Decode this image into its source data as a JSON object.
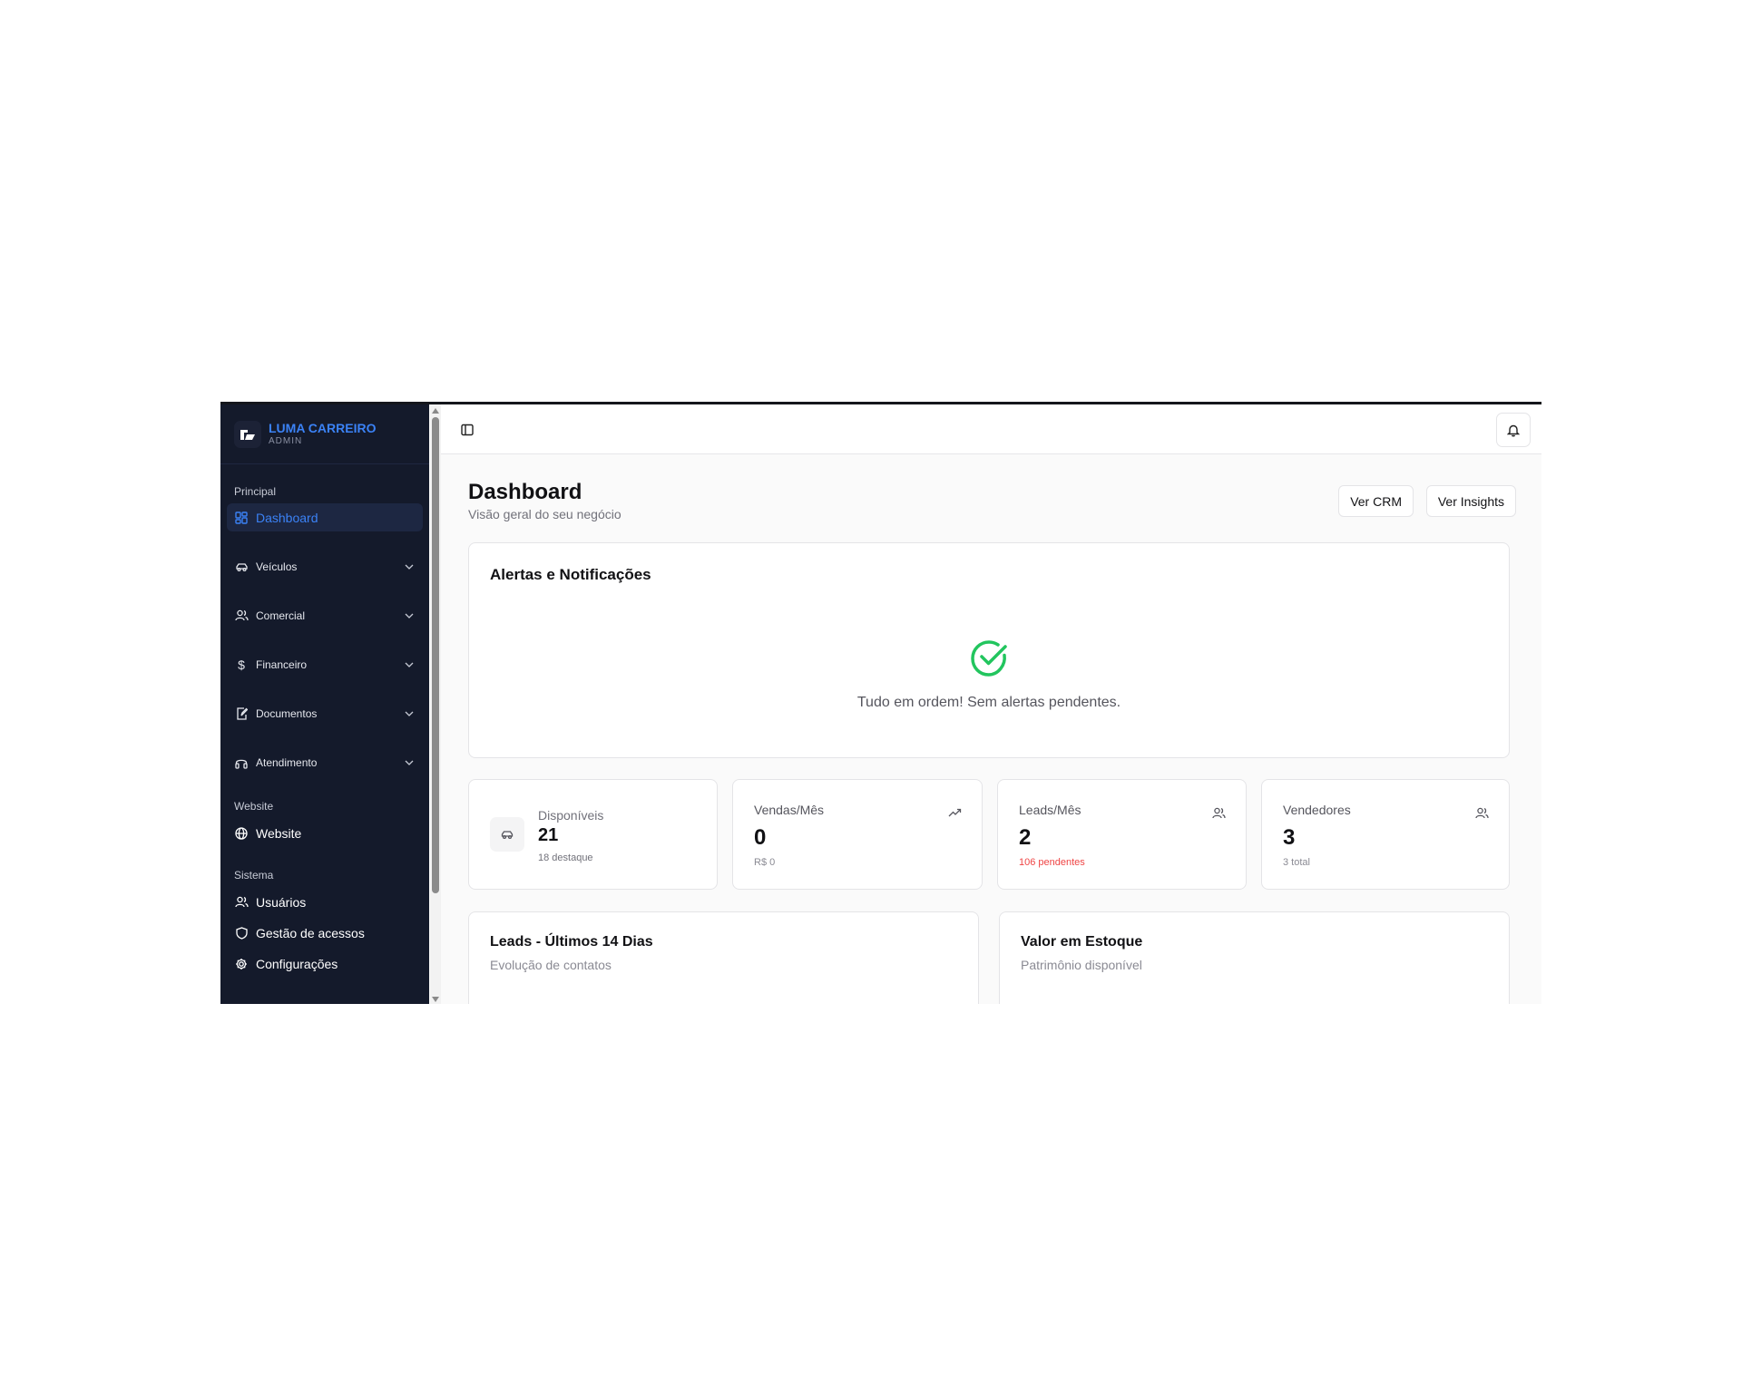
{
  "brand": {
    "name": "LUMA CARREIRO",
    "role": "ADMIN"
  },
  "sidebar": {
    "section_principal": "Principal",
    "dashboard": "Dashboard",
    "groups": [
      {
        "label": "Veículos",
        "icon": "car-icon"
      },
      {
        "label": "Comercial",
        "icon": "users-icon"
      },
      {
        "label": "Financeiro",
        "icon": "dollar-icon"
      },
      {
        "label": "Documentos",
        "icon": "document-edit-icon"
      },
      {
        "label": "Atendimento",
        "icon": "headset-icon"
      }
    ],
    "section_website": "Website",
    "website": "Website",
    "section_sistema": "Sistema",
    "usuarios": "Usuários",
    "gestao": "Gestão de acessos",
    "config": "Configurações"
  },
  "page": {
    "title": "Dashboard",
    "subtitle": "Visão geral do seu negócio",
    "btn_crm": "Ver CRM",
    "btn_insights": "Ver Insights"
  },
  "alerts": {
    "title": "Alertas e Notificações",
    "message": "Tudo em ordem! Sem alertas pendentes."
  },
  "stats": {
    "disponiveis": {
      "label": "Disponíveis",
      "value": "21",
      "foot": "18 destaque"
    },
    "vendas": {
      "label": "Vendas/Mês",
      "value": "0",
      "foot": "R$ 0"
    },
    "leads": {
      "label": "Leads/Mês",
      "value": "2",
      "foot": "106 pendentes"
    },
    "vendedores": {
      "label": "Vendedores",
      "value": "3",
      "foot": "3 total"
    }
  },
  "charts": {
    "leads": {
      "title": "Leads - Últimos 14 Dias",
      "subtitle": "Evolução de contatos"
    },
    "estoque": {
      "title": "Valor em Estoque",
      "subtitle": "Patrimônio disponível"
    }
  },
  "colors": {
    "sidebar_bg": "#141a2b",
    "accent": "#3b82f6",
    "success": "#22c55e",
    "danger": "#ef4444"
  }
}
